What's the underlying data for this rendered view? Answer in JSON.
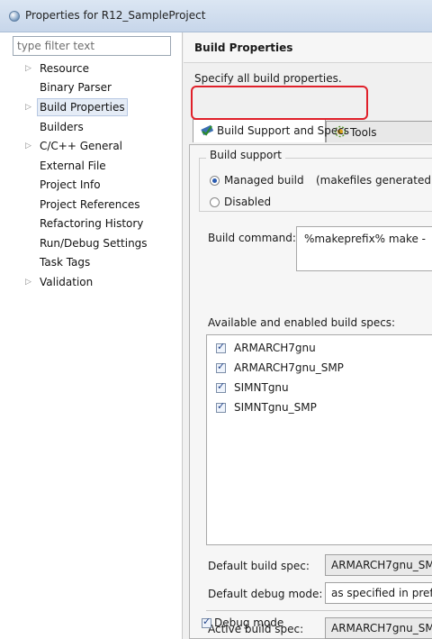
{
  "window": {
    "title": "Properties for R12_SampleProject"
  },
  "filter": {
    "placeholder": "type filter text"
  },
  "tree": {
    "items": [
      {
        "label": "Resource",
        "expandable": true
      },
      {
        "label": "Binary Parser",
        "expandable": false
      },
      {
        "label": "Build Properties",
        "expandable": true,
        "selected": true
      },
      {
        "label": "Builders",
        "expandable": false
      },
      {
        "label": "C/C++ General",
        "expandable": true
      },
      {
        "label": "External File",
        "expandable": false
      },
      {
        "label": "Project Info",
        "expandable": false
      },
      {
        "label": "Project References",
        "expandable": false
      },
      {
        "label": "Refactoring History",
        "expandable": false
      },
      {
        "label": "Run/Debug Settings",
        "expandable": false
      },
      {
        "label": "Task Tags",
        "expandable": false
      },
      {
        "label": "Validation",
        "expandable": true
      }
    ]
  },
  "page": {
    "title": "Build Properties",
    "description": "Specify all build properties."
  },
  "tabs": [
    {
      "label": "Build Support and Specs",
      "icon": "build-support-icon",
      "active": true
    },
    {
      "label": "Tools",
      "icon": "tools-icon",
      "active": false
    }
  ],
  "build_support": {
    "legend": "Build support",
    "managed_label": "Managed build",
    "managed_note": "(makefiles generated",
    "disabled_label": "Disabled",
    "selected": "managed"
  },
  "build_command": {
    "label": "Build command:",
    "value": "%makeprefix% make -"
  },
  "specs": {
    "label": "Available and enabled build specs:",
    "items": [
      {
        "label": "ARMARCH7gnu",
        "checked": true
      },
      {
        "label": "ARMARCH7gnu_SMP",
        "checked": true
      },
      {
        "label": "SIMNTgnu",
        "checked": true
      },
      {
        "label": "SIMNTgnu_SMP",
        "checked": true
      }
    ]
  },
  "defaults": {
    "build_spec_label": "Default build spec:",
    "build_spec_value": "ARMARCH7gnu_SM",
    "debug_mode_label": "Default debug mode:",
    "debug_mode_value": "as specified in pref",
    "active_spec_label": "Active build spec:",
    "active_spec_value": "ARMARCH7gnu_SM"
  },
  "debug_mode": {
    "label": "Debug mode",
    "checked": true
  },
  "colors": {
    "highlight": "#e0202a",
    "selection": "#e5ecf6",
    "accent": "#2a5bb0"
  }
}
